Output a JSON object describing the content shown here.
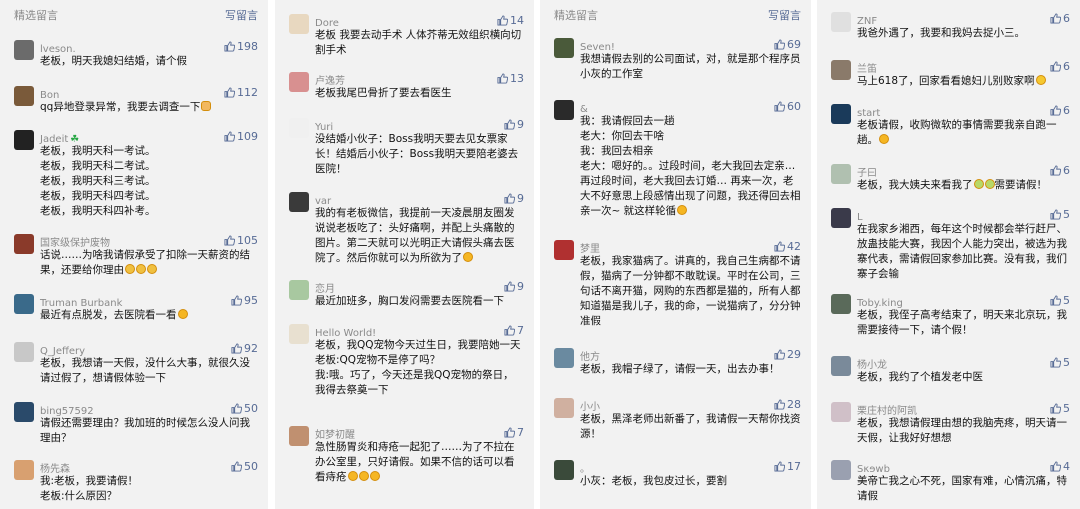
{
  "panels": [
    {
      "header": {
        "title": "精选留言",
        "action": "写留言"
      },
      "comments": [
        {
          "nick": "lveson.",
          "likes": "198",
          "text": "老板，明天我媳妇结婚，请个假",
          "avatar": "#6b6b6b"
        },
        {
          "nick": "Bon",
          "likes": "112",
          "text": "qq异地登录异常，我要去调查一下",
          "emoji": [
            "pray-emoji"
          ],
          "avatar": "#7a5a3a"
        },
        {
          "nick": "Jadeit",
          "badge": "clover-icon",
          "likes": "109",
          "text": "老板，我明天科一考试。\n老板，我明天科二考试。\n老板，我明天科三考试。\n老板，我明天科四考试。\n老板，我明天科四补考。",
          "avatar": "#222222"
        },
        {
          "nick": "国家级保护废物",
          "likes": "105",
          "text": "话说……为啥我请假承受了扣除一天薪资的结果，还要给你理由",
          "emoji": [
            "cry-emoji",
            "cry-emoji",
            "cry-emoji"
          ],
          "avatar": "#8a3a2a"
        },
        {
          "nick": "Truman Burbank",
          "likes": "95",
          "text": "最近有点脱发，去医院看一看",
          "emoji": [
            "smile-emoji"
          ],
          "avatar": "#3a6a8a"
        },
        {
          "nick": "Q_Jeffery",
          "likes": "92",
          "text": "老板，我想请一天假，没什么大事，就很久没请过假了，想请假体验一下",
          "avatar": "#c8c8c8"
        },
        {
          "nick": "bing57592",
          "likes": "50",
          "text": "请假还需要理由？我加班的时候怎么没人问我理由？",
          "avatar": "#2a4a6a"
        },
        {
          "nick": "杨先森",
          "likes": "50",
          "text": "我:老板，我要请假！\n老板:什么原因？",
          "avatar": "#d8a070"
        }
      ]
    },
    {
      "header": {
        "title": "",
        "action": ""
      },
      "comments": [
        {
          "nick": "Dore",
          "likes": "14",
          "text": "老板 我要去动手术 人体芥蒂无效组织横向切割手术",
          "avatar": "#e8d8c0"
        },
        {
          "nick": "卢逸芳",
          "likes": "13",
          "text": "老板我尾巴骨折了要去看医生",
          "avatar": "#d89090"
        },
        {
          "nick": "Yuri",
          "likes": "9",
          "text": "没结婚小伙子：Boss我明天要去见女票家长！结婚后小伙子：Boss我明天要陪老婆去医院！",
          "avatar": "#f0f0f0"
        },
        {
          "nick": "var",
          "likes": "9",
          "text": "我的有老板微信，我提前一天凌晨朋友圈发说说老板吃了：头好痛啊，并配上头痛散的图片。第二天就可以光明正大请假头痛去医院了。然后你就可以为所欲为了",
          "emoji": [
            "smile-emoji"
          ],
          "avatar": "#3a3a3a"
        },
        {
          "nick": "恋月",
          "likes": "9",
          "text": "最近加班多，胸口发闷需要去医院看一下",
          "avatar": "#a8c8a0"
        },
        {
          "nick": "Hello World!",
          "likes": "7",
          "text": "老板，我QQ宠物今天过生日，我要陪她一天\n老板:QQ宠物不是停了吗？\n我:哦。巧了，今天还是我QQ宠物的祭日，我得去祭奠一下",
          "avatar": "#e8e0d0"
        },
        {
          "nick": "如梦初醒",
          "likes": "7",
          "text": "急性肠胃炎和痔疮一起犯了……为了不拉在办公室里，只好请假。如果不信的话可以看看痔疮",
          "emoji": [
            "smile-emoji",
            "smile-emoji",
            "smile-emoji"
          ],
          "avatar": "#c09070"
        }
      ]
    },
    {
      "header": {
        "title": "精选留言",
        "action": "写留言"
      },
      "comments": [
        {
          "nick": "Seven!",
          "likes": "69",
          "text": "我想请假去别的公司面试，对，就是那个程序员小灰的工作室",
          "avatar": "#4a5a3a"
        },
        {
          "nick": "&",
          "likes": "60",
          "text": "我：我请假回去一趟\n老大：你回去干啥\n我：我回去相亲\n老大：嗯好的。。过段时间，老大我回去定亲…再过段时间，老大我回去订婚… 再来一次，老大不好意思上段感情出现了问题，我还得回去相亲一次~ 就这样轮循",
          "emoji": [
            "smile-emoji"
          ],
          "avatar": "#2a2a2a"
        },
        {
          "nick": "梦里",
          "likes": "42",
          "text": "老板，我家猫病了。讲真的，我自己生病都不请假，猫病了一分钟都不敢耽误。平时在公司，三句话不离开猫，网购的东西都是猫的，所有人都知道猫是我儿子，我的命，一说猫病了，分分钟准假",
          "avatar": "#b03030"
        },
        {
          "nick": "他方",
          "likes": "29",
          "text": "老板，我帽子绿了，请假一天，出去办事！",
          "avatar": "#6a8aa0"
        },
        {
          "nick": "小小",
          "likes": "28",
          "text": "老板，黑泽老师出新番了，我请假一天帮你找资源！",
          "avatar": "#d0b0a0"
        },
        {
          "nick": "。",
          "likes": "17",
          "text": "小灰：老板，我包皮过长，要割",
          "avatar": "#3a4a3a"
        }
      ]
    },
    {
      "header": {
        "title": "",
        "action": ""
      },
      "comments": [
        {
          "nick": "ZNF",
          "likes": "6",
          "text": "我爸外遇了，我要和我妈去捉小三。",
          "avatar": "#e0e0e0"
        },
        {
          "nick": "兰笛",
          "likes": "6",
          "text": "马上618了，回家看看媳妇儿别败家啊",
          "emoji": [
            "laugh-emoji"
          ],
          "avatar": "#8a7a6a"
        },
        {
          "nick": "start",
          "likes": "6",
          "text": "老板请假，收购微软的事情需要我亲自跑一趟。",
          "emoji": [
            "smile-emoji"
          ],
          "avatar": "#1a3a5a"
        },
        {
          "nick": "子曰",
          "likes": "6",
          "text": "老板，我大姨夫来看我了",
          "emoji": [
            "grin-emoji",
            "grin-emoji"
          ],
          "text_after": "需要请假！",
          "avatar": "#b0c0b0"
        },
        {
          "nick": "L",
          "likes": "5",
          "text": "在我家乡湘西，每年这个时候都会举行赶尸、放蛊技能大赛，我因个人能力突出，被选为我寨代表，需请假回家参加比赛。没有我，我们寨子会输",
          "avatar": "#3a3a4a"
        },
        {
          "nick": "Toby.king",
          "likes": "5",
          "text": "老板，我侄子高考结束了，明天来北京玩，我需要接待一下，请个假！",
          "avatar": "#5a6a5a"
        },
        {
          "nick": "杨小龙",
          "likes": "5",
          "text": "老板，我约了个植发老中医",
          "avatar": "#7a8a9a"
        },
        {
          "nick": "栗庄村的阿凯",
          "likes": "5",
          "text": "老板，我想请假理由想的我脑壳疼，明天请一天假，让我好好想想",
          "avatar": "#d0c0c8"
        },
        {
          "nick": "Sκɘwb",
          "likes": "4",
          "text": "美帝亡我之心不死，国家有难，心情沉痛，特请假",
          "avatar": "#9aa0b0"
        }
      ]
    }
  ]
}
